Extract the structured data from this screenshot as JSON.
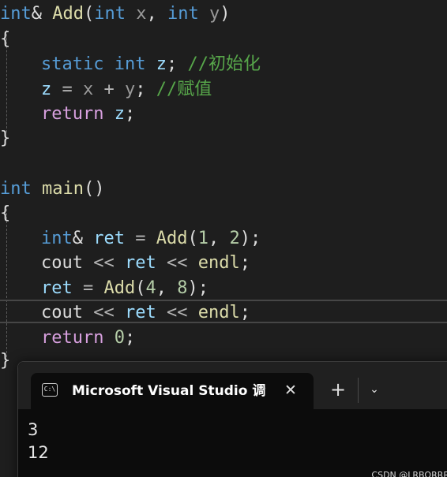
{
  "colors": {
    "editor_bg": "#1e1e1e",
    "keyword": "#569cd6",
    "control_keyword": "#d8a0df",
    "function": "#dcdcaa",
    "variable": "#9cdcfe",
    "parameter": "#9a9a9a",
    "number": "#b5cea8",
    "comment": "#57a64a",
    "terminal_bg": "#0c0c0c"
  },
  "code": {
    "l1": {
      "int": "int",
      "amp": "&",
      "fn": "Add",
      "lp": "(",
      "int2": "int",
      "x": "x",
      "comma": ",",
      "int3": "int",
      "y": "y",
      "rp": ")"
    },
    "l2": {
      "brace": "{"
    },
    "l3": {
      "static": "static",
      "int": "int",
      "z": "z",
      "semi": ";",
      "comment": "//初始化"
    },
    "l4": {
      "z": "z",
      "eq": "=",
      "x": "x",
      "plus": "+",
      "y": "y",
      "semi": ";",
      "comment": "//赋值"
    },
    "l5": {
      "ret": "return",
      "z": "z",
      "semi": ";"
    },
    "l6": {
      "brace": "}"
    },
    "l8": {
      "int": "int",
      "fn": "main",
      "parens": "()"
    },
    "l9": {
      "brace": "{"
    },
    "l10": {
      "int": "int",
      "amp": "&",
      "ret": "ret",
      "eq": "=",
      "fn": "Add",
      "lp": "(",
      "a": "1",
      "comma": ",",
      "b": "2",
      "rp": ")",
      "semi": ";"
    },
    "l11": {
      "cout": "cout",
      "op1": "<<",
      "ret": "ret",
      "op2": "<<",
      "endl": "endl",
      "semi": ";"
    },
    "l12": {
      "ret": "ret",
      "eq": "=",
      "fn": "Add",
      "lp": "(",
      "a": "4",
      "comma": ",",
      "b": "8",
      "rp": ")",
      "semi": ";"
    },
    "l13": {
      "cout": "cout",
      "op1": "<<",
      "ret": "ret",
      "op2": "<<",
      "endl": "endl",
      "semi": ";"
    },
    "l14": {
      "ret": "return",
      "zero": "0",
      "semi": ";"
    },
    "l15": {
      "brace": "}"
    }
  },
  "terminal": {
    "tab_icon": "C:\\",
    "tab_title": "Microsoft Visual Studio 调试控制台",
    "close_label": "✕",
    "new_tab_label": "+",
    "dropdown_label": "⌄",
    "output_lines": [
      "3",
      "12"
    ]
  },
  "watermark": "CSDN @LRBORRR"
}
